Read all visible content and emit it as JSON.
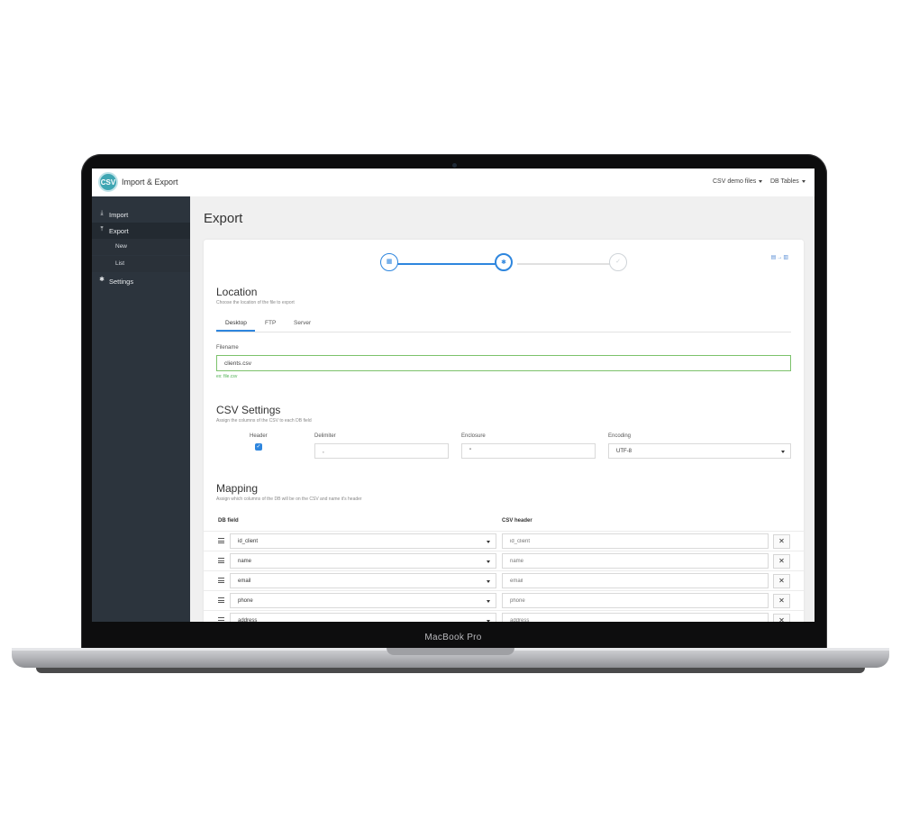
{
  "device": {
    "brand_label": "MacBook Pro"
  },
  "header": {
    "logo_text": "CSV",
    "app_title": "Import & Export",
    "menus": [
      {
        "label": "CSV demo files"
      },
      {
        "label": "DB Tables"
      }
    ]
  },
  "sidebar": {
    "items": [
      {
        "label": "Import",
        "icon": "download-icon"
      },
      {
        "label": "Export",
        "icon": "upload-icon",
        "active": true
      },
      {
        "label": "New"
      },
      {
        "label": "List"
      },
      {
        "label": "Settings",
        "icon": "gear-icon"
      }
    ]
  },
  "page": {
    "title": "Export",
    "stepper": {
      "current_step": 2,
      "total_steps": 3,
      "icons": [
        "table-icon",
        "gear-icon",
        "check-icon"
      ]
    },
    "location": {
      "title": "Location",
      "subtitle": "Choose the location of the file to export",
      "tabs": [
        {
          "label": "Desktop",
          "active": true
        },
        {
          "label": "FTP"
        },
        {
          "label": "Server"
        }
      ],
      "filename_label": "Filename",
      "filename_value": "clients.csv",
      "filename_hint": "ex: file.csv"
    },
    "csv_settings": {
      "title": "CSV Settings",
      "subtitle": "Assign the columns of the CSV to each DB field",
      "header_label": "Header",
      "header_checked": true,
      "delimiter_label": "Delimiter",
      "delimiter_value": ",",
      "enclosure_label": "Enclosure",
      "enclosure_value": "\"",
      "encoding_label": "Encoding",
      "encoding_value": "UTF-8"
    },
    "mapping": {
      "title": "Mapping",
      "subtitle": "Assign which columns of the DB will be on the CSV and name it's header",
      "col_db": "DB field",
      "col_csv": "CSV header",
      "rows": [
        {
          "db_field": "id_client",
          "csv_header": "id_client"
        },
        {
          "db_field": "name",
          "csv_header": "name"
        },
        {
          "db_field": "email",
          "csv_header": "email"
        },
        {
          "db_field": "phone",
          "csv_header": "phone"
        },
        {
          "db_field": "address",
          "csv_header": "address"
        }
      ],
      "remove_label": "✕"
    }
  },
  "colors": {
    "accent": "#2e86de",
    "sidebar": "#2c343d",
    "valid": "#7cc26b",
    "logo": "#3fa6b3"
  }
}
